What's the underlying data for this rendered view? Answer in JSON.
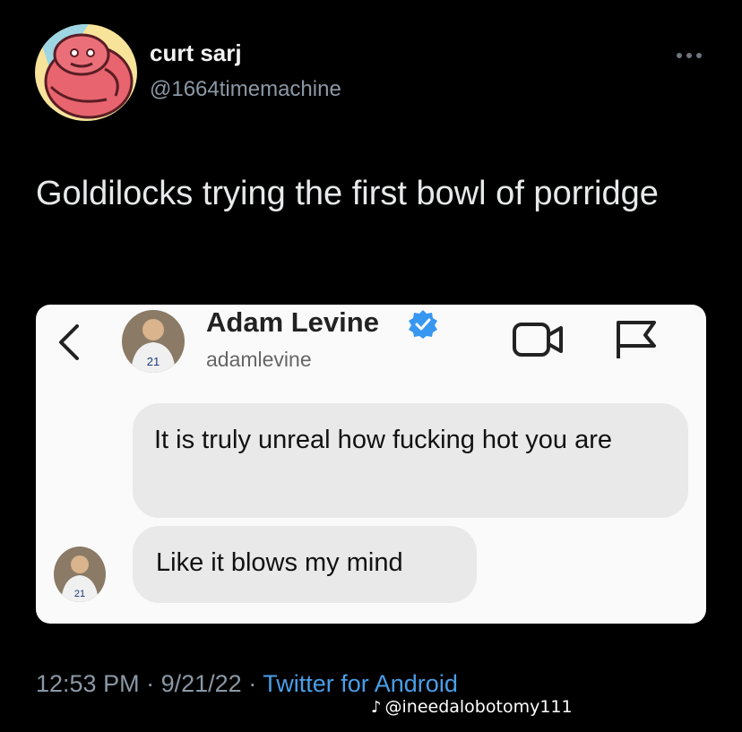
{
  "tweet": {
    "display_name": "curt sarj",
    "handle": "@1664timemachine",
    "text": "Goldilocks trying the first bowl of porridge",
    "timestamp_time": "12:53 PM",
    "separator": "·",
    "timestamp_date": "9/21/22",
    "source": "Twitter for Android",
    "more_icon": "more-horizontal-icon"
  },
  "embedded_dm": {
    "name": "Adam Levine",
    "username": "adamlevine",
    "verified": true,
    "jersey_number": "21",
    "icons": [
      "chevron-left-icon",
      "video-camera-icon",
      "flag-icon",
      "verified-badge-icon"
    ],
    "messages": [
      {
        "text": "It is truly unreal how fucking hot you are"
      },
      {
        "text": "Like it blows my mind"
      }
    ]
  },
  "watermark": {
    "text": "@ineedalobotomy111",
    "icon": "tiktok-icon"
  },
  "colors": {
    "background": "#000000",
    "handle_gray": "#8b98a5",
    "link_blue": "#4a9ee8",
    "verified_blue": "#3897f0",
    "bubble_gray": "#e9e9e9",
    "card_bg": "#fafafa"
  }
}
